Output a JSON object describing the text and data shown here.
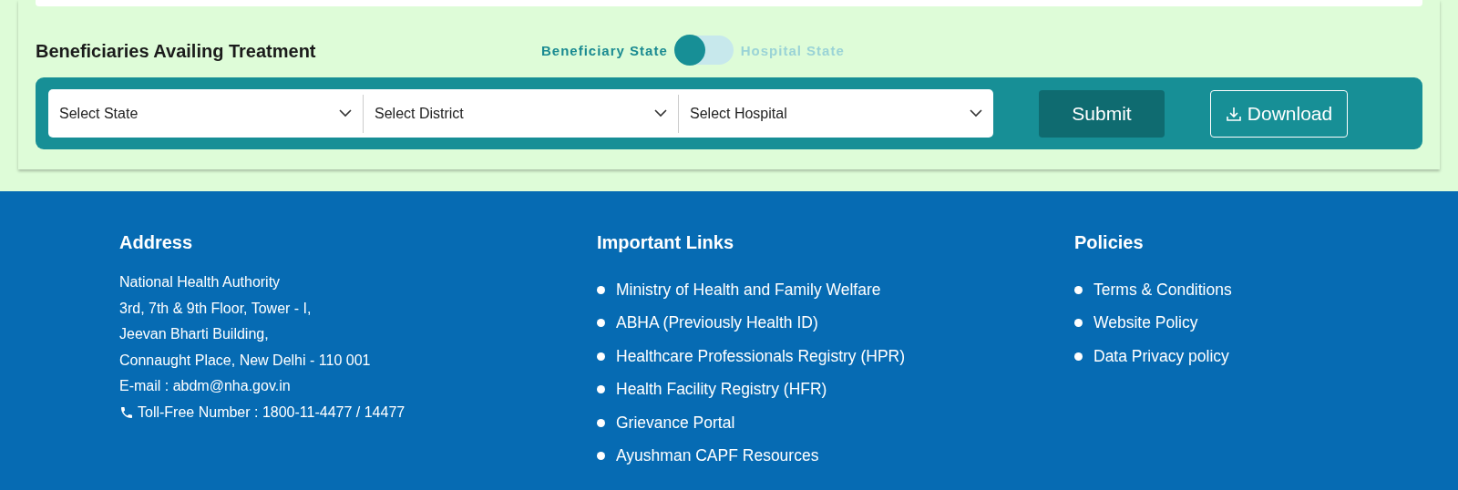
{
  "section": {
    "title": "Beneficiaries Availing Treatment",
    "toggle": [
      {
        "label": "Beneficiary State",
        "selected": true
      },
      {
        "label": "Hospital State",
        "selected": false
      }
    ],
    "selects": [
      {
        "placeholder": "Select State"
      },
      {
        "placeholder": "Select District"
      },
      {
        "placeholder": "Select Hospital"
      }
    ],
    "buttons": [
      {
        "kind": "submit",
        "label": "Submit"
      },
      {
        "kind": "download",
        "label": "Download"
      }
    ]
  },
  "footer": {
    "address": {
      "heading": "Address",
      "lines": [
        "National Health Authority",
        "3rd, 7th & 9th Floor, Tower - I,",
        "Jeevan Bharti Building,",
        "Connaught Place, New Delhi - 110 001",
        "E-mail : abdm@nha.gov.in"
      ],
      "phone": "Toll-Free Number : 1800-11-4477 / 14477"
    },
    "columns": [
      {
        "heading": "Important Links",
        "links": [
          "Ministry of Health and Family Welfare",
          "ABHA (Previously Health ID)",
          "Healthcare Professionals Registry (HPR)",
          "Health Facility Registry (HFR)",
          "Grievance Portal",
          "Ayushman CAPF Resources"
        ]
      },
      {
        "heading": "Policies",
        "links": [
          "Terms & Conditions",
          "Website Policy",
          "Data Privacy policy"
        ]
      }
    ]
  }
}
